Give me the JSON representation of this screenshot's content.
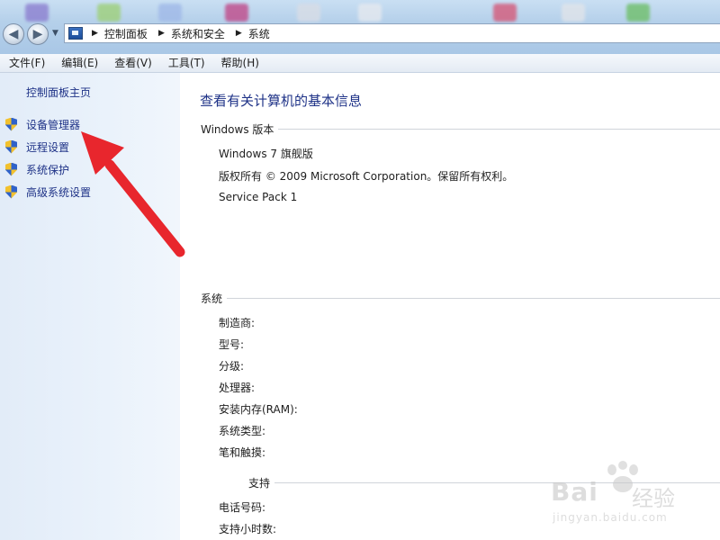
{
  "address_bar": {
    "breadcrumbs": [
      "控制面板",
      "系统和安全",
      "系统"
    ]
  },
  "menu": [
    "文件(F)",
    "编辑(E)",
    "查看(V)",
    "工具(T)",
    "帮助(H)"
  ],
  "left_pane": {
    "home_link": "控制面板主页",
    "tasks": [
      "设备管理器",
      "远程设置",
      "系统保护",
      "高级系统设置"
    ]
  },
  "main": {
    "title": "查看有关计算机的基本信息",
    "windows_edition": {
      "heading": "Windows 版本",
      "lines": [
        "Windows 7 旗舰版",
        "版权所有 © 2009 Microsoft Corporation。保留所有权利。",
        "Service Pack 1"
      ]
    },
    "system": {
      "heading": "系统",
      "labels": [
        "制造商:",
        "型号:",
        "分级:",
        "处理器:",
        "安装内存(RAM):",
        "系统类型:",
        "笔和触摸:"
      ]
    },
    "support": {
      "heading": "支持",
      "labels": [
        "电话号码:",
        "支持小时数:"
      ]
    }
  },
  "annotation": {
    "arrow_color": "#e8262d",
    "points_to": "设备管理器"
  },
  "watermark": {
    "brand": "Bai",
    "brand_cn": "经验",
    "url": "jingyan.baidu.com"
  },
  "colors": {
    "link": "#1e3287",
    "left_pane_bg": "#e6eff9",
    "title_bar": "#b9d3ec"
  }
}
